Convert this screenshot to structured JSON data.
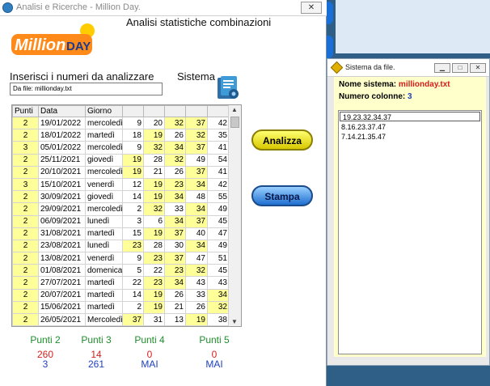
{
  "window_title": "Analisi e Ricerche - Million Day.",
  "close_glyph": "✕",
  "logo_text_1": "Million",
  "logo_text_2": "DAY",
  "heading": "Analisi statistiche combinazioni",
  "input_label": "Inserisci i numeri da analizzare",
  "sistema_label": "Sistema",
  "file_field_value": "Da file: millionday.txt",
  "columns": [
    "Punti",
    "Data",
    "Giorno"
  ],
  "rows": [
    {
      "punti": "2",
      "data": "19/01/2022",
      "giorno": "mercoledì",
      "n": [
        "9",
        "20",
        "32",
        "37",
        "42"
      ],
      "hl": [
        false,
        false,
        true,
        true,
        false
      ]
    },
    {
      "punti": "2",
      "data": "18/01/2022",
      "giorno": "martedì",
      "n": [
        "18",
        "19",
        "26",
        "32",
        "35"
      ],
      "hl": [
        false,
        true,
        false,
        true,
        false
      ]
    },
    {
      "punti": "3",
      "data": "05/01/2022",
      "giorno": "mercoledì",
      "n": [
        "9",
        "32",
        "34",
        "37",
        "41"
      ],
      "hl": [
        false,
        true,
        true,
        true,
        false
      ]
    },
    {
      "punti": "2",
      "data": "25/11/2021",
      "giorno": "giovedì",
      "n": [
        "19",
        "28",
        "32",
        "49",
        "54"
      ],
      "hl": [
        true,
        false,
        true,
        false,
        false
      ]
    },
    {
      "punti": "2",
      "data": "20/10/2021",
      "giorno": "mercoledì",
      "n": [
        "19",
        "21",
        "26",
        "37",
        "41"
      ],
      "hl": [
        true,
        false,
        false,
        true,
        false
      ]
    },
    {
      "punti": "3",
      "data": "15/10/2021",
      "giorno": "venerdì",
      "n": [
        "12",
        "19",
        "23",
        "34",
        "42"
      ],
      "hl": [
        false,
        true,
        true,
        true,
        false
      ]
    },
    {
      "punti": "2",
      "data": "30/09/2021",
      "giorno": "giovedì",
      "n": [
        "14",
        "19",
        "34",
        "48",
        "55"
      ],
      "hl": [
        false,
        true,
        true,
        false,
        false
      ]
    },
    {
      "punti": "2",
      "data": "29/09/2021",
      "giorno": "mercoledì",
      "n": [
        "2",
        "32",
        "33",
        "34",
        "49"
      ],
      "hl": [
        false,
        true,
        false,
        true,
        false
      ]
    },
    {
      "punti": "2",
      "data": "06/09/2021",
      "giorno": "lunedì",
      "n": [
        "3",
        "6",
        "34",
        "37",
        "45"
      ],
      "hl": [
        false,
        false,
        true,
        true,
        false
      ]
    },
    {
      "punti": "2",
      "data": "31/08/2021",
      "giorno": "martedì",
      "n": [
        "15",
        "19",
        "37",
        "40",
        "47"
      ],
      "hl": [
        false,
        true,
        true,
        false,
        false
      ]
    },
    {
      "punti": "2",
      "data": "23/08/2021",
      "giorno": "lunedì",
      "n": [
        "23",
        "28",
        "30",
        "34",
        "49"
      ],
      "hl": [
        true,
        false,
        false,
        true,
        false
      ]
    },
    {
      "punti": "2",
      "data": "13/08/2021",
      "giorno": "venerdì",
      "n": [
        "9",
        "23",
        "37",
        "47",
        "51"
      ],
      "hl": [
        false,
        true,
        true,
        false,
        false
      ]
    },
    {
      "punti": "2",
      "data": "01/08/2021",
      "giorno": "domenica",
      "n": [
        "5",
        "22",
        "23",
        "32",
        "45"
      ],
      "hl": [
        false,
        false,
        true,
        true,
        false
      ]
    },
    {
      "punti": "2",
      "data": "27/07/2021",
      "giorno": "martedì",
      "n": [
        "22",
        "23",
        "34",
        "43",
        "43"
      ],
      "hl": [
        false,
        true,
        true,
        false,
        false
      ]
    },
    {
      "punti": "2",
      "data": "20/07/2021",
      "giorno": "martedì",
      "n": [
        "14",
        "19",
        "26",
        "33",
        "34"
      ],
      "hl": [
        false,
        true,
        false,
        false,
        true
      ]
    },
    {
      "punti": "2",
      "data": "15/06/2021",
      "giorno": "martedì",
      "n": [
        "2",
        "19",
        "21",
        "26",
        "32"
      ],
      "hl": [
        false,
        true,
        false,
        false,
        true
      ]
    },
    {
      "punti": "2",
      "data": "26/05/2021",
      "giorno": "Mercoledì",
      "n": [
        "37",
        "31",
        "13",
        "19",
        "38"
      ],
      "hl": [
        true,
        false,
        false,
        true,
        false
      ]
    },
    {
      "punti": "3",
      "data": "19/05/2021",
      "giorno": "Mercoledì",
      "n": [
        "23",
        "32",
        "53",
        "37",
        "45"
      ],
      "hl": [
        true,
        true,
        false,
        true,
        false
      ]
    },
    {
      "punti": "2",
      "data": "04/02/2021",
      "giorno": "giovedì",
      "n": [
        "2",
        "19",
        "32",
        "33",
        "54"
      ],
      "hl": [
        false,
        true,
        true,
        false,
        false
      ]
    },
    {
      "punti": "2",
      "data": "24/01/2021",
      "giorno": "domenica",
      "n": [
        "1",
        "2",
        "23",
        "24",
        "37"
      ],
      "hl": [
        false,
        false,
        true,
        false,
        true
      ]
    }
  ],
  "buttons": {
    "analizza": "Analizza",
    "stampa": "Stampa"
  },
  "stats": [
    {
      "label": "Punti 2",
      "v1": "260",
      "v2": "3"
    },
    {
      "label": "Punti 3",
      "v1": "14",
      "v2": "261"
    },
    {
      "label": "Punti 4",
      "v1": "0",
      "v2": "MAI"
    },
    {
      "label": "Punti 5",
      "v1": "0",
      "v2": "MAI"
    }
  ],
  "dialog": {
    "title": "Sistema da file.",
    "name_label": "Nome sistema:",
    "name_value": "millionday.txt",
    "cols_label": "Numero colonne:",
    "cols_value": "3",
    "combos": [
      "19.23.32.34.37",
      "8.16.23.37.47",
      "7.14.21.35.47"
    ]
  },
  "colors": {
    "highlight": "#ffff99",
    "green": "#1e8e2c",
    "red": "#d62020",
    "blue": "#1f3fbf"
  }
}
